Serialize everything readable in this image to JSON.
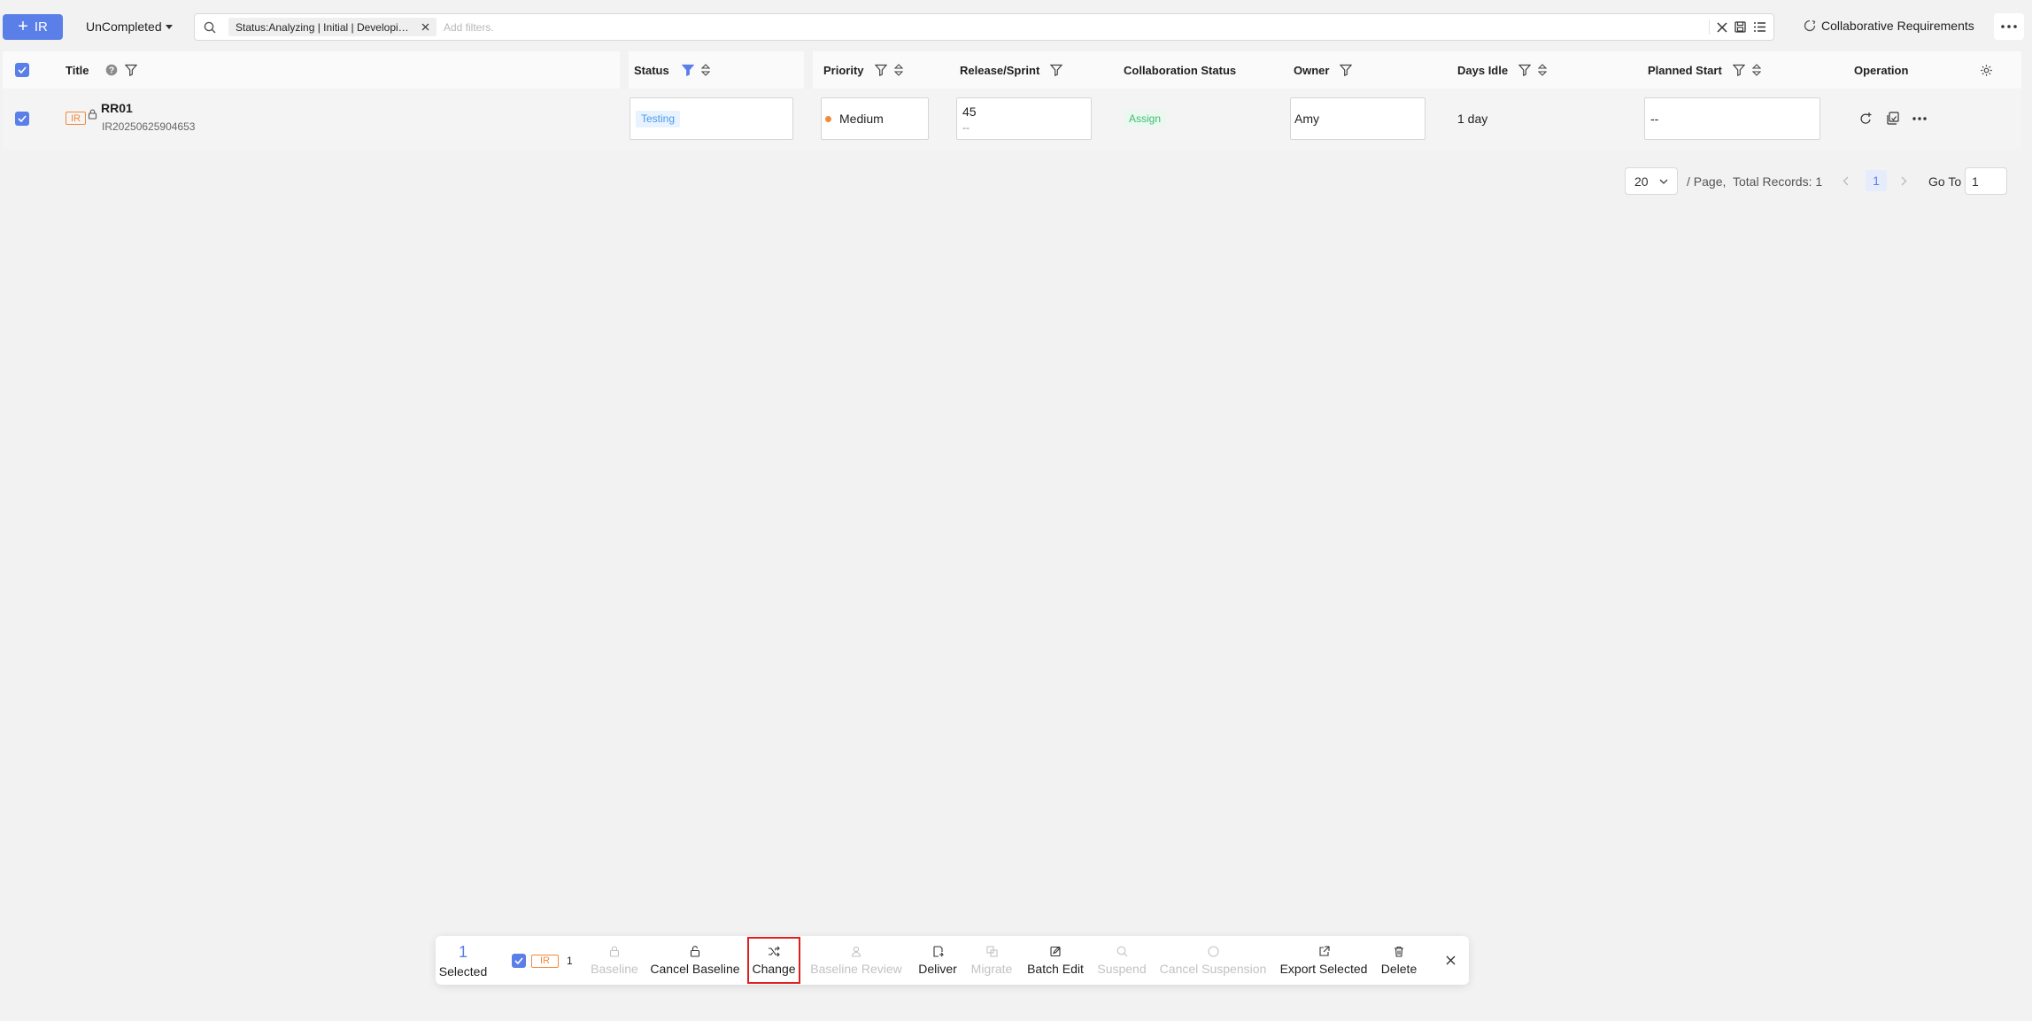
{
  "toolbar": {
    "add_label": "IR",
    "view_label": "UnCompleted",
    "filter_tag": "Status:Analyzing | Initial | Developing | Testing",
    "search_placeholder": "Add filters.",
    "collab_label": "Collaborative Requirements"
  },
  "table": {
    "columns": {
      "title": "Title",
      "status": "Status",
      "priority": "Priority",
      "release": "Release/Sprint",
      "collab": "Collaboration Status",
      "owner": "Owner",
      "days_idle": "Days Idle",
      "planned_start": "Planned Start",
      "operation": "Operation"
    },
    "rows": [
      {
        "type_badge": "IR",
        "title": "RR01",
        "id": "IR20250625904653",
        "status": "Testing",
        "priority": "Medium",
        "release": "45",
        "sprint": "--",
        "collab_status": "Assign",
        "owner": "Amy",
        "days_idle": "1 day",
        "planned_start": "--"
      }
    ]
  },
  "pagination": {
    "page_size": "20",
    "per_page_label": "/ Page,",
    "total_label": "Total Records: 1",
    "current_page": "1",
    "goto_label": "Go To",
    "goto_value": "1"
  },
  "actionbar": {
    "selected_count": "1",
    "selected_label": "Selected",
    "type_badge": "IR",
    "type_count": "1",
    "actions": {
      "baseline": "Baseline",
      "cancel_baseline": "Cancel Baseline",
      "change": "Change",
      "baseline_review": "Baseline Review",
      "deliver": "Deliver",
      "migrate": "Migrate",
      "batch_edit": "Batch Edit",
      "suspend": "Suspend",
      "cancel_suspension": "Cancel Suspension",
      "export_selected": "Export Selected",
      "delete": "Delete"
    }
  },
  "colors": {
    "primary": "#5b7fe8",
    "ir_orange": "#f08a3c",
    "status_blue": "#4a9be8",
    "assign_green": "#3fbf73",
    "highlight_red": "#e02020"
  }
}
